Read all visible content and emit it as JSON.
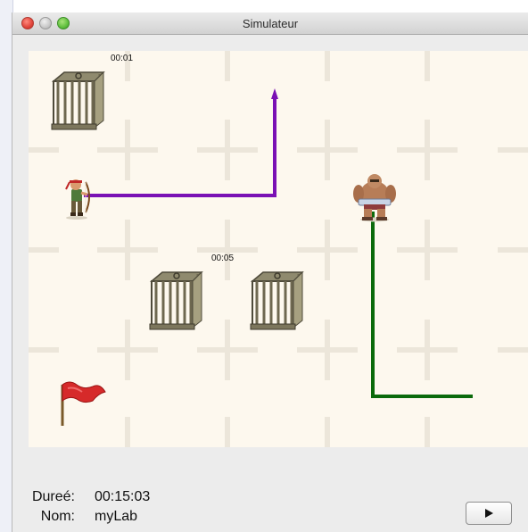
{
  "window": {
    "title": "Simulateur"
  },
  "board": {
    "labels": {
      "cage1_time": "00:01",
      "cage2_time": "00:05"
    },
    "path_colors": {
      "archer": "#7a11b4",
      "ogre": "#0b6a0b"
    }
  },
  "info": {
    "duration_label": "Dureé:",
    "duration_value": "00:15:03",
    "name_label": "Nom:",
    "name_value": "myLab"
  },
  "controls": {
    "play_icon": "play-icon"
  }
}
